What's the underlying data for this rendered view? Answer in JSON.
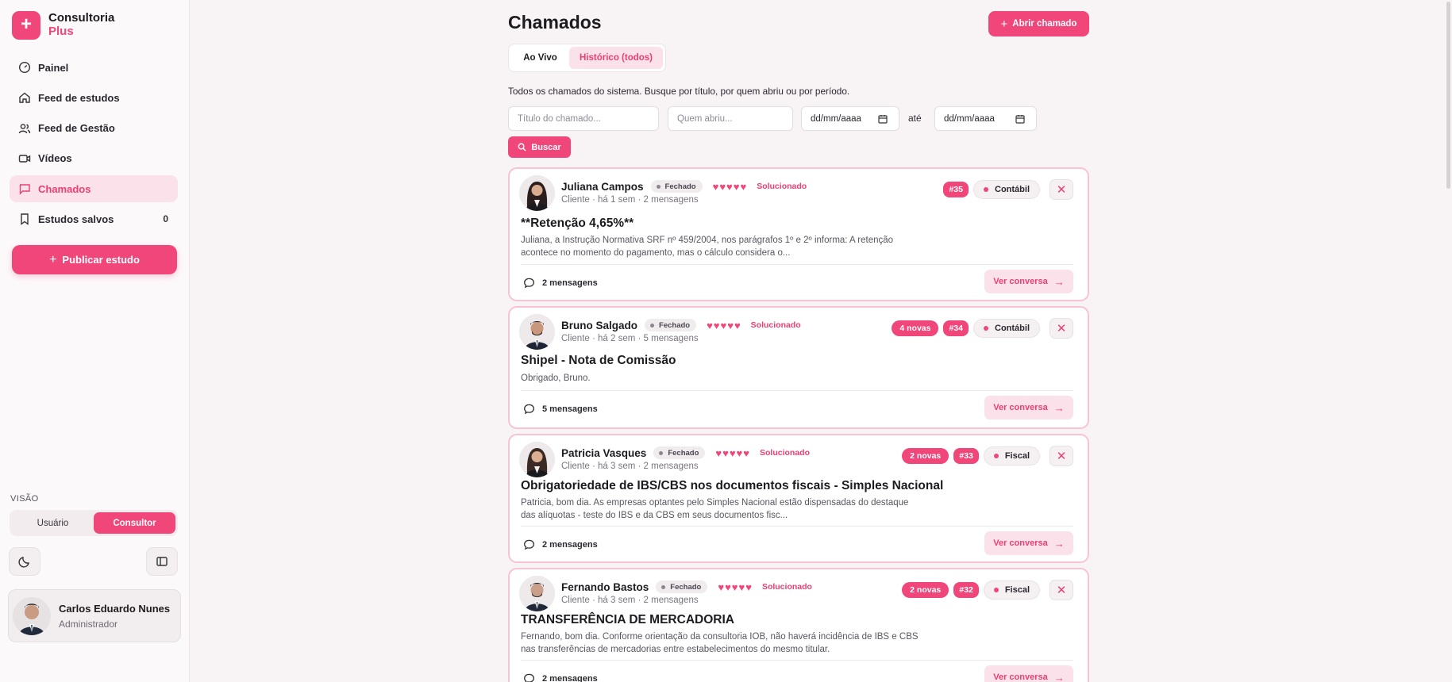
{
  "brand": {
    "line1": "Consultoria",
    "line2": "Plus"
  },
  "sidebar": {
    "items": [
      {
        "label": "Painel",
        "icon": "gauge-icon"
      },
      {
        "label": "Feed de estudos",
        "icon": "home-icon"
      },
      {
        "label": "Feed de Gestão",
        "icon": "users-icon"
      },
      {
        "label": "Vídeos",
        "icon": "video-icon"
      },
      {
        "label": "Chamados",
        "icon": "chat-icon",
        "active": true
      },
      {
        "label": "Estudos salvos",
        "icon": "bookmark-icon",
        "count": "0"
      }
    ],
    "publish_label": "Publicar estudo",
    "visao_label": "VISÃO",
    "visao_options": [
      "Usuário",
      "Consultor"
    ],
    "visao_selected": "Consultor"
  },
  "user": {
    "name": "Carlos Eduardo Nunes",
    "role": "Administrador"
  },
  "header": {
    "title": "Chamados",
    "open_button": "Abrir chamado"
  },
  "tabs": [
    "Ao Vivo",
    "Histórico (todos)"
  ],
  "description": "Todos os chamados do sistema. Busque por título, por quem abriu ou por período.",
  "filters": {
    "title_placeholder": "Título do chamado...",
    "author_placeholder": "Quem abriu...",
    "date_from": "dd/mm/aaaa",
    "ate": "até",
    "date_to": "dd/mm/aaaa",
    "search_label": "Buscar"
  },
  "tickets": [
    {
      "name": "Juliana Campos",
      "status": "Fechado",
      "hearts": 5,
      "hearts_text": "♥♥♥♥♥",
      "resolution": "Solucionado",
      "meta": "Cliente · há 1 sem · 2 mensagens",
      "new_badge": "",
      "number": "#35",
      "category": "Contábil",
      "title": "**Retenção 4,65%**",
      "body": "Juliana, a Instrução Normativa SRF nº 459/2004, nos parágrafos 1º e 2º informa: A retenção acontece no momento do pagamento, mas o cálculo considera o...",
      "messages": "2 mensagens",
      "action": "Ver conversa"
    },
    {
      "name": "Bruno Salgado",
      "status": "Fechado",
      "hearts": 5,
      "hearts_text": "♥♥♥♥♥",
      "resolution": "Solucionado",
      "meta": "Cliente · há 2 sem · 5 mensagens",
      "new_badge": "4 novas",
      "number": "#34",
      "category": "Contábil",
      "title": "Shipel - Nota de Comissão",
      "body": "Obrigado, Bruno.",
      "messages": "5 mensagens",
      "action": "Ver conversa"
    },
    {
      "name": "Patricia Vasques",
      "status": "Fechado",
      "hearts": 5,
      "hearts_text": "♥♥♥♥♥",
      "resolution": "Solucionado",
      "meta": "Cliente · há 3 sem · 2 mensagens",
      "new_badge": "2 novas",
      "number": "#33",
      "category": "Fiscal",
      "title": "Obrigatoriedade de IBS/CBS nos documentos fiscais - Simples Nacional",
      "body": "Patricia, bom dia. As empresas optantes pelo Simples Nacional estão dispensadas do destaque das alíquotas - teste do IBS e da CBS em seus documentos fisc...",
      "messages": "2 mensagens",
      "action": "Ver conversa"
    },
    {
      "name": "Fernando Bastos",
      "status": "Fechado",
      "hearts": 5,
      "hearts_text": "♥♥♥♥♥",
      "resolution": "Solucionado",
      "meta": "Cliente · há 3 sem · 2 mensagens",
      "new_badge": "2 novas",
      "number": "#32",
      "category": "Fiscal",
      "title": "TRANSFERÊNCIA DE MERCADORIA",
      "body": "Fernando, bom dia. Conforme orientação da consultoria IOB, não haverá incidência de IBS e CBS nas transferências de mercadorias entre estabelecimentos do mesmo titular.",
      "messages": "2 mensagens",
      "action": "Ver conversa"
    }
  ]
}
